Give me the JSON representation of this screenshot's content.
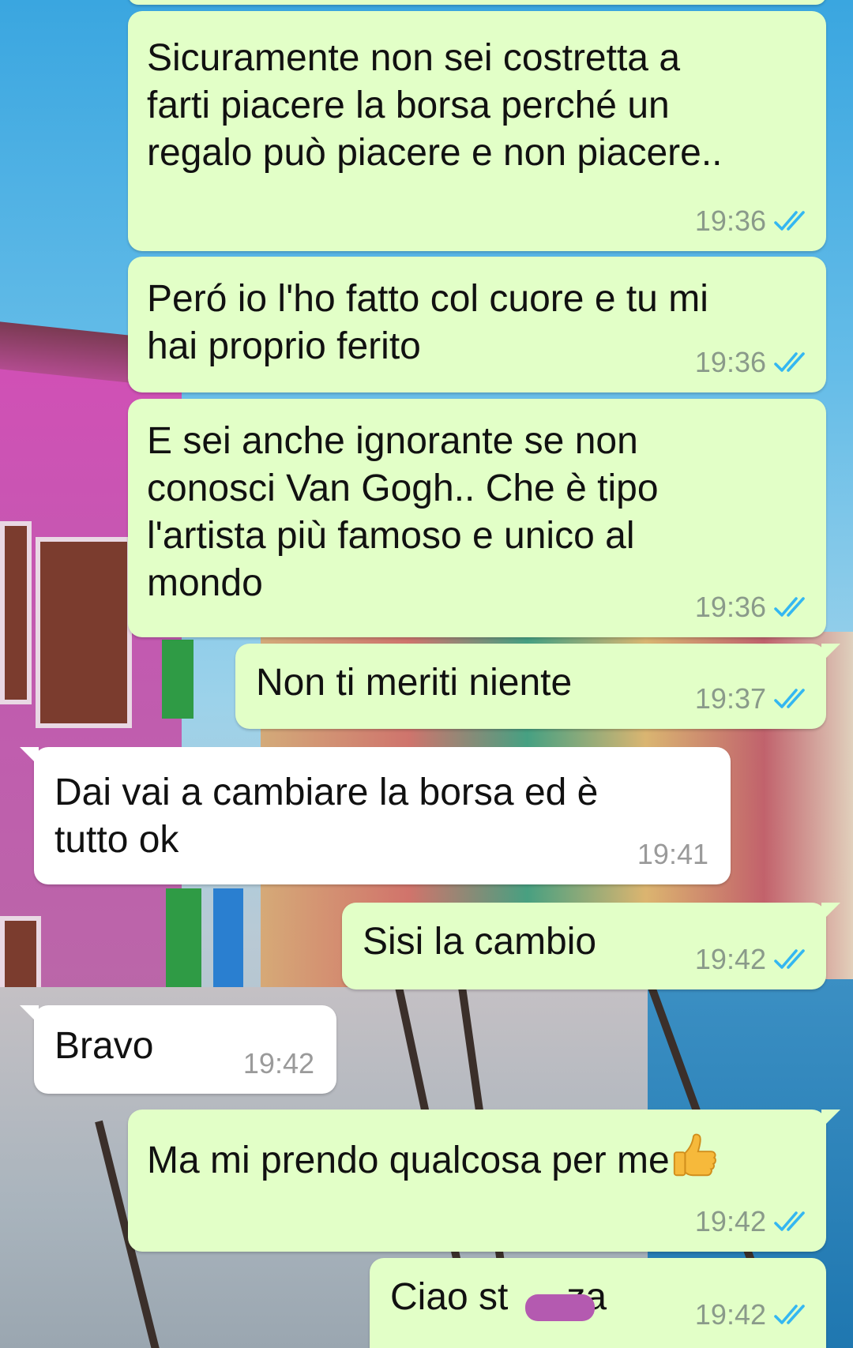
{
  "messages": [
    {
      "direction": "out",
      "text": "Sicuramente non sei costretta a\nfarti piacere la borsa perché un\nregalo può piacere e non piacere..",
      "time": "19:36",
      "status": "read"
    },
    {
      "direction": "out",
      "text": "Peró io l'ho fatto col cuore e tu mi\nhai proprio ferito",
      "time": "19:36",
      "status": "read"
    },
    {
      "direction": "out",
      "text": "E sei anche ignorante se non\nconosci Van Gogh.. Che è tipo\nl'artista più famoso e unico al\nmondo",
      "time": "19:36",
      "status": "read"
    },
    {
      "direction": "out",
      "text": "Non ti meriti niente",
      "time": "19:37",
      "status": "read"
    },
    {
      "direction": "in",
      "text": "Dai vai a cambiare la borsa ed è\ntutto ok",
      "time": "19:41"
    },
    {
      "direction": "out",
      "text": "Sisi la cambio",
      "time": "19:42",
      "status": "read"
    },
    {
      "direction": "in",
      "text": "Bravo",
      "time": "19:42"
    },
    {
      "direction": "out",
      "text": "Ma mi prendo qualcosa per me",
      "emoji": "thumbs-up-emoji",
      "time": "19:42",
      "status": "read"
    },
    {
      "direction": "out",
      "text_before": "Ciao st",
      "text_after": "za",
      "redacted": true,
      "time": "19:42",
      "status": "read"
    }
  ],
  "colors": {
    "outgoing_bubble": "#e2ffc7",
    "incoming_bubble": "#ffffff",
    "read_ticks": "#34b7f1",
    "timestamp": "#8a9a8a",
    "redaction": "#b45ab0"
  }
}
